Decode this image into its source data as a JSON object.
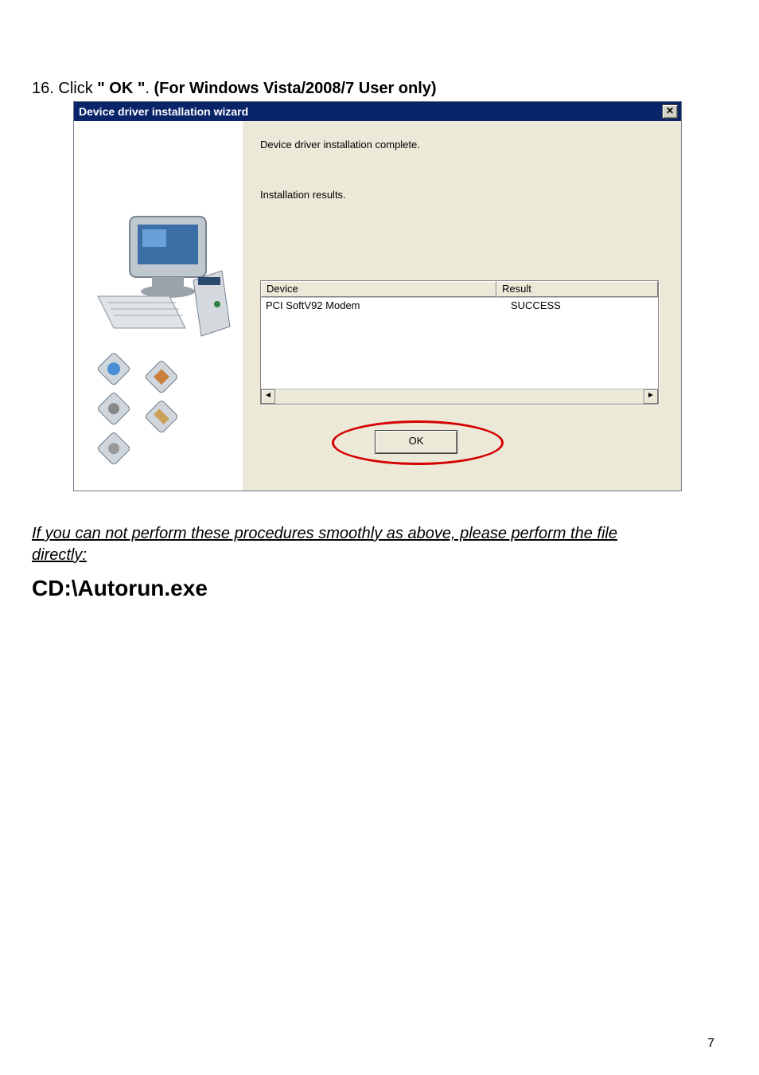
{
  "step": {
    "number": "16.",
    "verb": "Click ",
    "quoted": "\" OK \"",
    "period": ". ",
    "paren": "(For Windows Vista/2008/7 User only)"
  },
  "dialog": {
    "title": "Device driver installation wizard",
    "close_glyph": "✕",
    "message1": "Device driver installation complete.",
    "message2": "Installation results.",
    "headers": {
      "device": "Device",
      "result": "Result"
    },
    "row": {
      "device": "PCI SoftV92 Modem",
      "result": "SUCCESS"
    },
    "scroll": {
      "left": "◄",
      "right": "►"
    },
    "ok_label": "OK"
  },
  "note": {
    "line1": "If you can not perform these procedures smoothly as above, please perform the file ",
    "line2": "directly:"
  },
  "cd_path": "CD:\\Autorun.exe",
  "page_number": "7"
}
